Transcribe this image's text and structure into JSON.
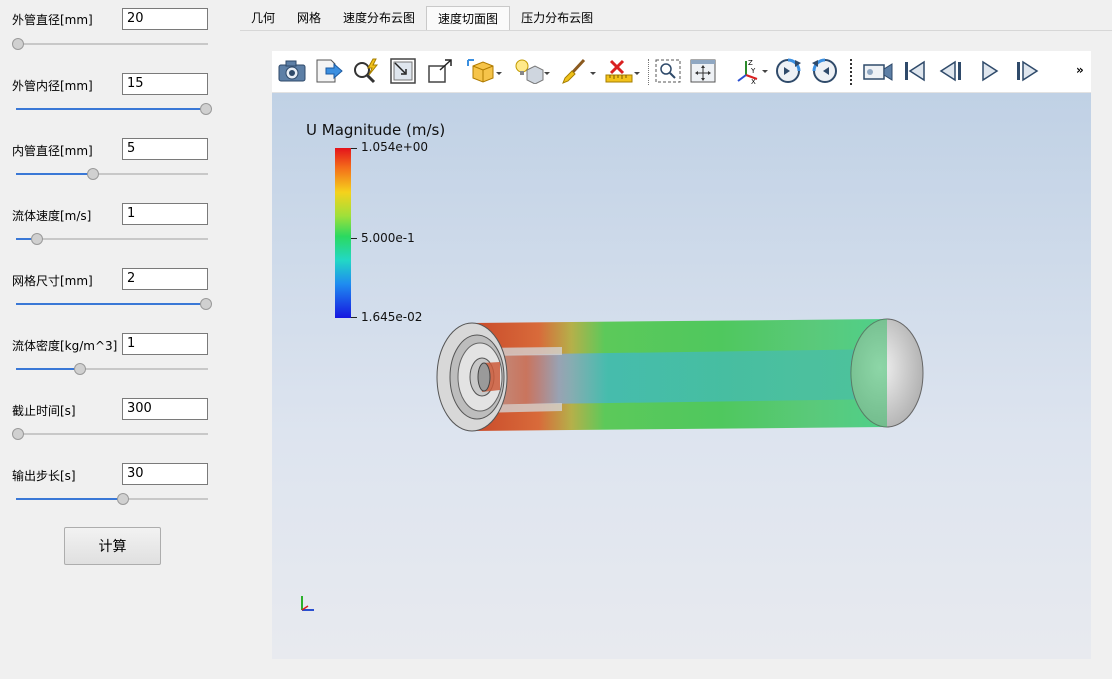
{
  "params": [
    {
      "label": "外管直径[mm]",
      "value": "20",
      "slider": 0.0
    },
    {
      "label": "外管内径[mm]",
      "value": "15",
      "slider": 1.0
    },
    {
      "label": "内管直径[mm]",
      "value": "5",
      "slider": 0.4
    },
    {
      "label": "流体速度[m/s]",
      "value": "1",
      "slider": 0.1
    },
    {
      "label": "网格尺寸[mm]",
      "value": "2",
      "slider": 1.0
    },
    {
      "label": "流体密度[kg/m^3]",
      "value": "1",
      "slider": 0.33
    },
    {
      "label": "截止时间[s]",
      "value": "300",
      "slider": 0.0
    },
    {
      "label": "输出步长[s]",
      "value": "30",
      "slider": 0.56
    }
  ],
  "calc_button": "计算",
  "tabs": [
    "几何",
    "网格",
    "速度分布云图",
    "速度切面图",
    "压力分布云图"
  ],
  "active_tab": 3,
  "colors": {
    "accent": "#3a78d6",
    "tab_active": "#fafafa"
  },
  "legend": {
    "title": "U Magnitude (m/s)",
    "max": "1.054e+00",
    "mid": "5.000e-1",
    "min": "1.645e-02"
  },
  "toolbar_icons": [
    "camera-icon",
    "export-icon",
    "magnifier-lightning-icon",
    "zoom-to-box-icon",
    "box-arrow-icon",
    "reset-camera-dropdown-icon",
    "light-dropdown-icon",
    "paintbrush-dropdown-icon",
    "ruler-clear-dropdown-icon",
    "zoom-to-selection-icon",
    "fit-view-icon",
    "axes-orientation-dropdown-icon",
    "rotate-ccw-icon",
    "rotate-cw-icon",
    "video-camera-icon",
    "first-frame-icon",
    "previous-frame-icon",
    "play-icon",
    "next-frame-icon"
  ],
  "more_glyph": "»"
}
